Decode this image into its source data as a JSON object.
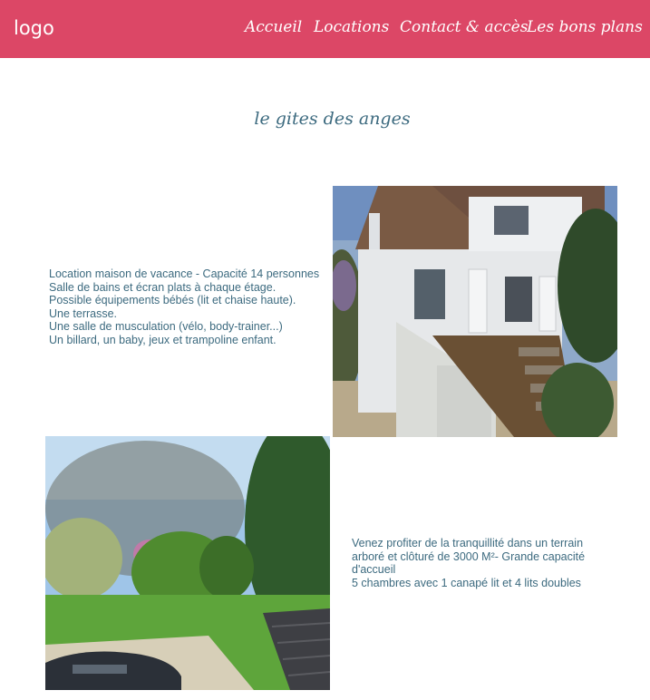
{
  "header": {
    "logo": "logo",
    "nav": [
      {
        "label": "Accueil"
      },
      {
        "label": "Locations"
      },
      {
        "label": "Contact & accès"
      },
      {
        "label": "Les bons plans"
      }
    ]
  },
  "main": {
    "title": "le gites des anges",
    "section1": {
      "lines": [
        "Location maison de vacance - Capacité 14 personnes",
        "Salle de bains et écran plats à chaque étage.",
        "Possible équipements bébés (lit et chaise haute).",
        "Une terrasse.",
        "Une salle de musculation (vélo, body-trainer...)",
        "Un billard, un baby, jeux et trampoline enfant."
      ]
    },
    "section2": {
      "lines": [
        "Venez profiter de la tranquillité dans un terrain",
        "arboré et clôturé de 3000 M²- Grande capacité",
        "d'accueil",
        "5 chambres avec 1 canapé lit et 4 lits doubles"
      ]
    }
  },
  "colors": {
    "header_bg": "#dc4766",
    "text": "#3c6a7f"
  }
}
